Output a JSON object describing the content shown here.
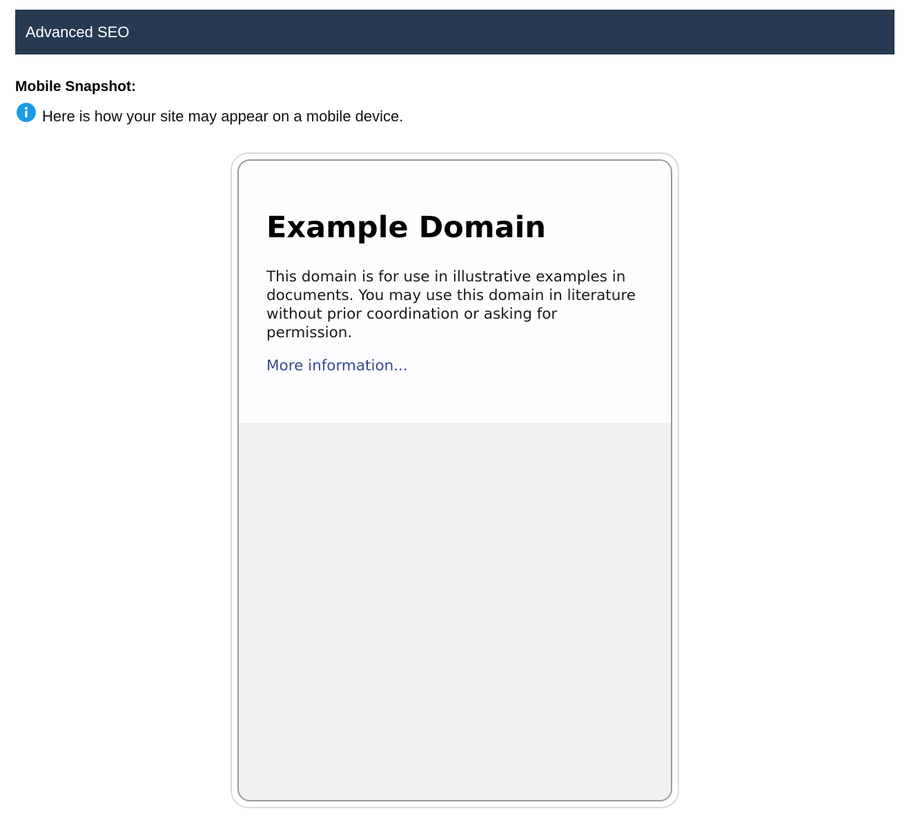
{
  "header": {
    "title": "Advanced SEO",
    "background_color": "#263a52"
  },
  "mobile_snapshot": {
    "label": "Mobile Snapshot:",
    "info_icon": "info-icon",
    "info_icon_color": "#1a9be6",
    "info_text": "Here is how your site may appear on a mobile device."
  },
  "preview": {
    "heading": "Example Domain",
    "body": "This domain is for use in illustrative examples in documents. You may use this domain in literature without prior coordination or asking for permission.",
    "link_text": "More information...",
    "link_color": "#38488f"
  }
}
